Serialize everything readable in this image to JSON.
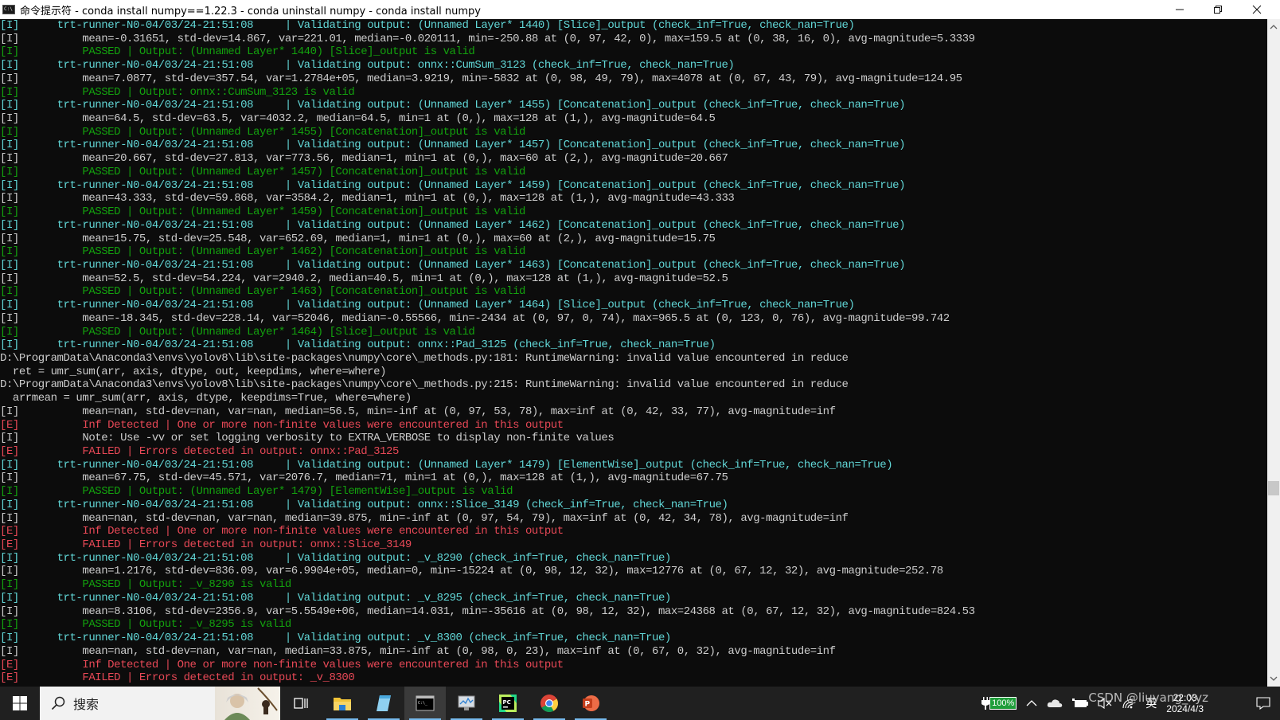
{
  "window": {
    "title": "命令提示符 - conda  install numpy==1.22.3 - conda  uninstall numpy - conda  install numpy",
    "app_icon": "cmd-icon",
    "controls": [
      "minimize",
      "maximize",
      "close"
    ]
  },
  "console": {
    "lines": [
      {
        "tag": "[I]",
        "tag_color": "teal",
        "indent": "      ",
        "text": "trt-runner-N0-04/03/24-21:51:08     | Validating output: (Unnamed Layer* 1440) [Slice]_output (check_inf=True, check_nan=True)",
        "color": "teal"
      },
      {
        "tag": "[I]",
        "tag_color": "gray",
        "indent": "          ",
        "text": "mean=-0.31651, std-dev=14.867, var=221.01, median=-0.020111, min=-250.88 at (0, 97, 42, 0), max=159.5 at (0, 38, 16, 0), avg-magnitude=5.3339",
        "color": "gray"
      },
      {
        "tag": "[I]",
        "tag_color": "green",
        "indent": "          ",
        "text": "PASSED | Output: (Unnamed Layer* 1440) [Slice]_output is valid",
        "color": "green"
      },
      {
        "tag": "[I]",
        "tag_color": "teal",
        "indent": "      ",
        "text": "trt-runner-N0-04/03/24-21:51:08     | Validating output: onnx::CumSum_3123 (check_inf=True, check_nan=True)",
        "color": "teal"
      },
      {
        "tag": "[I]",
        "tag_color": "gray",
        "indent": "          ",
        "text": "mean=7.0877, std-dev=357.54, var=1.2784e+05, median=3.9219, min=-5832 at (0, 98, 49, 79), max=4078 at (0, 67, 43, 79), avg-magnitude=124.95",
        "color": "gray"
      },
      {
        "tag": "[I]",
        "tag_color": "green",
        "indent": "          ",
        "text": "PASSED | Output: onnx::CumSum_3123 is valid",
        "color": "green"
      },
      {
        "tag": "[I]",
        "tag_color": "teal",
        "indent": "      ",
        "text": "trt-runner-N0-04/03/24-21:51:08     | Validating output: (Unnamed Layer* 1455) [Concatenation]_output (check_inf=True, check_nan=True)",
        "color": "teal"
      },
      {
        "tag": "[I]",
        "tag_color": "gray",
        "indent": "          ",
        "text": "mean=64.5, std-dev=63.5, var=4032.2, median=64.5, min=1 at (0,), max=128 at (1,), avg-magnitude=64.5",
        "color": "gray"
      },
      {
        "tag": "[I]",
        "tag_color": "green",
        "indent": "          ",
        "text": "PASSED | Output: (Unnamed Layer* 1455) [Concatenation]_output is valid",
        "color": "green"
      },
      {
        "tag": "[I]",
        "tag_color": "teal",
        "indent": "      ",
        "text": "trt-runner-N0-04/03/24-21:51:08     | Validating output: (Unnamed Layer* 1457) [Concatenation]_output (check_inf=True, check_nan=True)",
        "color": "teal"
      },
      {
        "tag": "[I]",
        "tag_color": "gray",
        "indent": "          ",
        "text": "mean=20.667, std-dev=27.813, var=773.56, median=1, min=1 at (0,), max=60 at (2,), avg-magnitude=20.667",
        "color": "gray"
      },
      {
        "tag": "[I]",
        "tag_color": "green",
        "indent": "          ",
        "text": "PASSED | Output: (Unnamed Layer* 1457) [Concatenation]_output is valid",
        "color": "green"
      },
      {
        "tag": "[I]",
        "tag_color": "teal",
        "indent": "      ",
        "text": "trt-runner-N0-04/03/24-21:51:08     | Validating output: (Unnamed Layer* 1459) [Concatenation]_output (check_inf=True, check_nan=True)",
        "color": "teal"
      },
      {
        "tag": "[I]",
        "tag_color": "gray",
        "indent": "          ",
        "text": "mean=43.333, std-dev=59.868, var=3584.2, median=1, min=1 at (0,), max=128 at (1,), avg-magnitude=43.333",
        "color": "gray"
      },
      {
        "tag": "[I]",
        "tag_color": "green",
        "indent": "          ",
        "text": "PASSED | Output: (Unnamed Layer* 1459) [Concatenation]_output is valid",
        "color": "green"
      },
      {
        "tag": "[I]",
        "tag_color": "teal",
        "indent": "      ",
        "text": "trt-runner-N0-04/03/24-21:51:08     | Validating output: (Unnamed Layer* 1462) [Concatenation]_output (check_inf=True, check_nan=True)",
        "color": "teal"
      },
      {
        "tag": "[I]",
        "tag_color": "gray",
        "indent": "          ",
        "text": "mean=15.75, std-dev=25.548, var=652.69, median=1, min=1 at (0,), max=60 at (2,), avg-magnitude=15.75",
        "color": "gray"
      },
      {
        "tag": "[I]",
        "tag_color": "green",
        "indent": "          ",
        "text": "PASSED | Output: (Unnamed Layer* 1462) [Concatenation]_output is valid",
        "color": "green"
      },
      {
        "tag": "[I]",
        "tag_color": "teal",
        "indent": "      ",
        "text": "trt-runner-N0-04/03/24-21:51:08     | Validating output: (Unnamed Layer* 1463) [Concatenation]_output (check_inf=True, check_nan=True)",
        "color": "teal"
      },
      {
        "tag": "[I]",
        "tag_color": "gray",
        "indent": "          ",
        "text": "mean=52.5, std-dev=54.224, var=2940.2, median=40.5, min=1 at (0,), max=128 at (1,), avg-magnitude=52.5",
        "color": "gray"
      },
      {
        "tag": "[I]",
        "tag_color": "green",
        "indent": "          ",
        "text": "PASSED | Output: (Unnamed Layer* 1463) [Concatenation]_output is valid",
        "color": "green"
      },
      {
        "tag": "[I]",
        "tag_color": "teal",
        "indent": "      ",
        "text": "trt-runner-N0-04/03/24-21:51:08     | Validating output: (Unnamed Layer* 1464) [Slice]_output (check_inf=True, check_nan=True)",
        "color": "teal"
      },
      {
        "tag": "[I]",
        "tag_color": "gray",
        "indent": "          ",
        "text": "mean=-18.345, std-dev=228.14, var=52046, median=-0.55566, min=-2434 at (0, 97, 0, 74), max=965.5 at (0, 123, 0, 76), avg-magnitude=99.742",
        "color": "gray"
      },
      {
        "tag": "[I]",
        "tag_color": "green",
        "indent": "          ",
        "text": "PASSED | Output: (Unnamed Layer* 1464) [Slice]_output is valid",
        "color": "green"
      },
      {
        "tag": "[I]",
        "tag_color": "teal",
        "indent": "      ",
        "text": "trt-runner-N0-04/03/24-21:51:08     | Validating output: onnx::Pad_3125 (check_inf=True, check_nan=True)",
        "color": "teal"
      },
      {
        "tag": "",
        "tag_color": "gray",
        "indent": "",
        "text": "D:\\ProgramData\\Anaconda3\\envs\\yolov8\\lib\\site-packages\\numpy\\core\\_methods.py:181: RuntimeWarning: invalid value encountered in reduce",
        "color": "gray"
      },
      {
        "tag": "",
        "tag_color": "gray",
        "indent": "",
        "text": "  ret = umr_sum(arr, axis, dtype, out, keepdims, where=where)",
        "color": "gray"
      },
      {
        "tag": "",
        "tag_color": "gray",
        "indent": "",
        "text": "D:\\ProgramData\\Anaconda3\\envs\\yolov8\\lib\\site-packages\\numpy\\core\\_methods.py:215: RuntimeWarning: invalid value encountered in reduce",
        "color": "gray"
      },
      {
        "tag": "",
        "tag_color": "gray",
        "indent": "",
        "text": "  arrmean = umr_sum(arr, axis, dtype, keepdims=True, where=where)",
        "color": "gray"
      },
      {
        "tag": "[I]",
        "tag_color": "gray",
        "indent": "          ",
        "text": "mean=nan, std-dev=nan, var=nan, median=56.5, min=-inf at (0, 97, 53, 78), max=inf at (0, 42, 33, 77), avg-magnitude=inf",
        "color": "gray"
      },
      {
        "tag": "[E]",
        "tag_color": "red",
        "indent": "          ",
        "text": "Inf Detected | One or more non-finite values were encountered in this output",
        "color": "red"
      },
      {
        "tag": "[I]",
        "tag_color": "gray",
        "indent": "          ",
        "text": "Note: Use -vv or set logging verbosity to EXTRA_VERBOSE to display non-finite values",
        "color": "gray"
      },
      {
        "tag": "[E]",
        "tag_color": "red",
        "indent": "          ",
        "text": "FAILED | Errors detected in output: onnx::Pad_3125",
        "color": "red"
      },
      {
        "tag": "[I]",
        "tag_color": "teal",
        "indent": "      ",
        "text": "trt-runner-N0-04/03/24-21:51:08     | Validating output: (Unnamed Layer* 1479) [ElementWise]_output (check_inf=True, check_nan=True)",
        "color": "teal"
      },
      {
        "tag": "[I]",
        "tag_color": "gray",
        "indent": "          ",
        "text": "mean=67.75, std-dev=45.571, var=2076.7, median=71, min=1 at (0,), max=128 at (1,), avg-magnitude=67.75",
        "color": "gray"
      },
      {
        "tag": "[I]",
        "tag_color": "green",
        "indent": "          ",
        "text": "PASSED | Output: (Unnamed Layer* 1479) [ElementWise]_output is valid",
        "color": "green"
      },
      {
        "tag": "[I]",
        "tag_color": "teal",
        "indent": "      ",
        "text": "trt-runner-N0-04/03/24-21:51:08     | Validating output: onnx::Slice_3149 (check_inf=True, check_nan=True)",
        "color": "teal"
      },
      {
        "tag": "[I]",
        "tag_color": "gray",
        "indent": "          ",
        "text": "mean=nan, std-dev=nan, var=nan, median=39.875, min=-inf at (0, 97, 54, 79), max=inf at (0, 42, 34, 78), avg-magnitude=inf",
        "color": "gray"
      },
      {
        "tag": "[E]",
        "tag_color": "red",
        "indent": "          ",
        "text": "Inf Detected | One or more non-finite values were encountered in this output",
        "color": "red"
      },
      {
        "tag": "[E]",
        "tag_color": "red",
        "indent": "          ",
        "text": "FAILED | Errors detected in output: onnx::Slice_3149",
        "color": "red"
      },
      {
        "tag": "[I]",
        "tag_color": "teal",
        "indent": "      ",
        "text": "trt-runner-N0-04/03/24-21:51:08     | Validating output: _v_8290 (check_inf=True, check_nan=True)",
        "color": "teal"
      },
      {
        "tag": "[I]",
        "tag_color": "gray",
        "indent": "          ",
        "text": "mean=1.2176, std-dev=836.09, var=6.9904e+05, median=0, min=-15224 at (0, 98, 12, 32), max=12776 at (0, 67, 12, 32), avg-magnitude=252.78",
        "color": "gray"
      },
      {
        "tag": "[I]",
        "tag_color": "green",
        "indent": "          ",
        "text": "PASSED | Output: _v_8290 is valid",
        "color": "green"
      },
      {
        "tag": "[I]",
        "tag_color": "teal",
        "indent": "      ",
        "text": "trt-runner-N0-04/03/24-21:51:08     | Validating output: _v_8295 (check_inf=True, check_nan=True)",
        "color": "teal"
      },
      {
        "tag": "[I]",
        "tag_color": "gray",
        "indent": "          ",
        "text": "mean=8.3106, std-dev=2356.9, var=5.5549e+06, median=14.031, min=-35616 at (0, 98, 12, 32), max=24368 at (0, 67, 12, 32), avg-magnitude=824.53",
        "color": "gray"
      },
      {
        "tag": "[I]",
        "tag_color": "green",
        "indent": "          ",
        "text": "PASSED | Output: _v_8295 is valid",
        "color": "green"
      },
      {
        "tag": "[I]",
        "tag_color": "teal",
        "indent": "      ",
        "text": "trt-runner-N0-04/03/24-21:51:08     | Validating output: _v_8300 (check_inf=True, check_nan=True)",
        "color": "teal"
      },
      {
        "tag": "[I]",
        "tag_color": "gray",
        "indent": "          ",
        "text": "mean=nan, std-dev=nan, var=nan, median=33.875, min=-inf at (0, 98, 0, 23), max=inf at (0, 67, 0, 32), avg-magnitude=inf",
        "color": "gray"
      },
      {
        "tag": "[E]",
        "tag_color": "red",
        "indent": "          ",
        "text": "Inf Detected | One or more non-finite values were encountered in this output",
        "color": "red"
      },
      {
        "tag": "[E]",
        "tag_color": "red",
        "indent": "          ",
        "text": "FAILED | Errors detected in output: _v_8300",
        "color": "red"
      }
    ]
  },
  "taskbar": {
    "search_placeholder": "搜索",
    "apps": [
      {
        "name": "task-view",
        "icon": "task-view-icon",
        "active": false
      },
      {
        "name": "file-explorer",
        "icon": "folder-icon",
        "active": false
      },
      {
        "name": "notepad",
        "icon": "notepad-icon",
        "active": false
      },
      {
        "name": "command-prompt",
        "icon": "terminal-icon",
        "active": true
      },
      {
        "name": "resource-monitor",
        "icon": "monitor-icon",
        "active": false
      },
      {
        "name": "pycharm",
        "icon": "pycharm-icon",
        "active": false
      },
      {
        "name": "chrome",
        "icon": "chrome-icon",
        "active": false
      },
      {
        "name": "powerpoint",
        "icon": "powerpoint-icon",
        "active": false
      }
    ],
    "tray": {
      "battery_percent": "100%",
      "ime": "英",
      "time": "22:03",
      "date": "2024/4/3",
      "watermark": "CSDN @liuyang_xyz"
    }
  },
  "colors": {
    "gray": "#cccccc",
    "teal": "#61d6d6",
    "green": "#13a10e",
    "red": "#e74856",
    "background": "#0c0c0c"
  }
}
